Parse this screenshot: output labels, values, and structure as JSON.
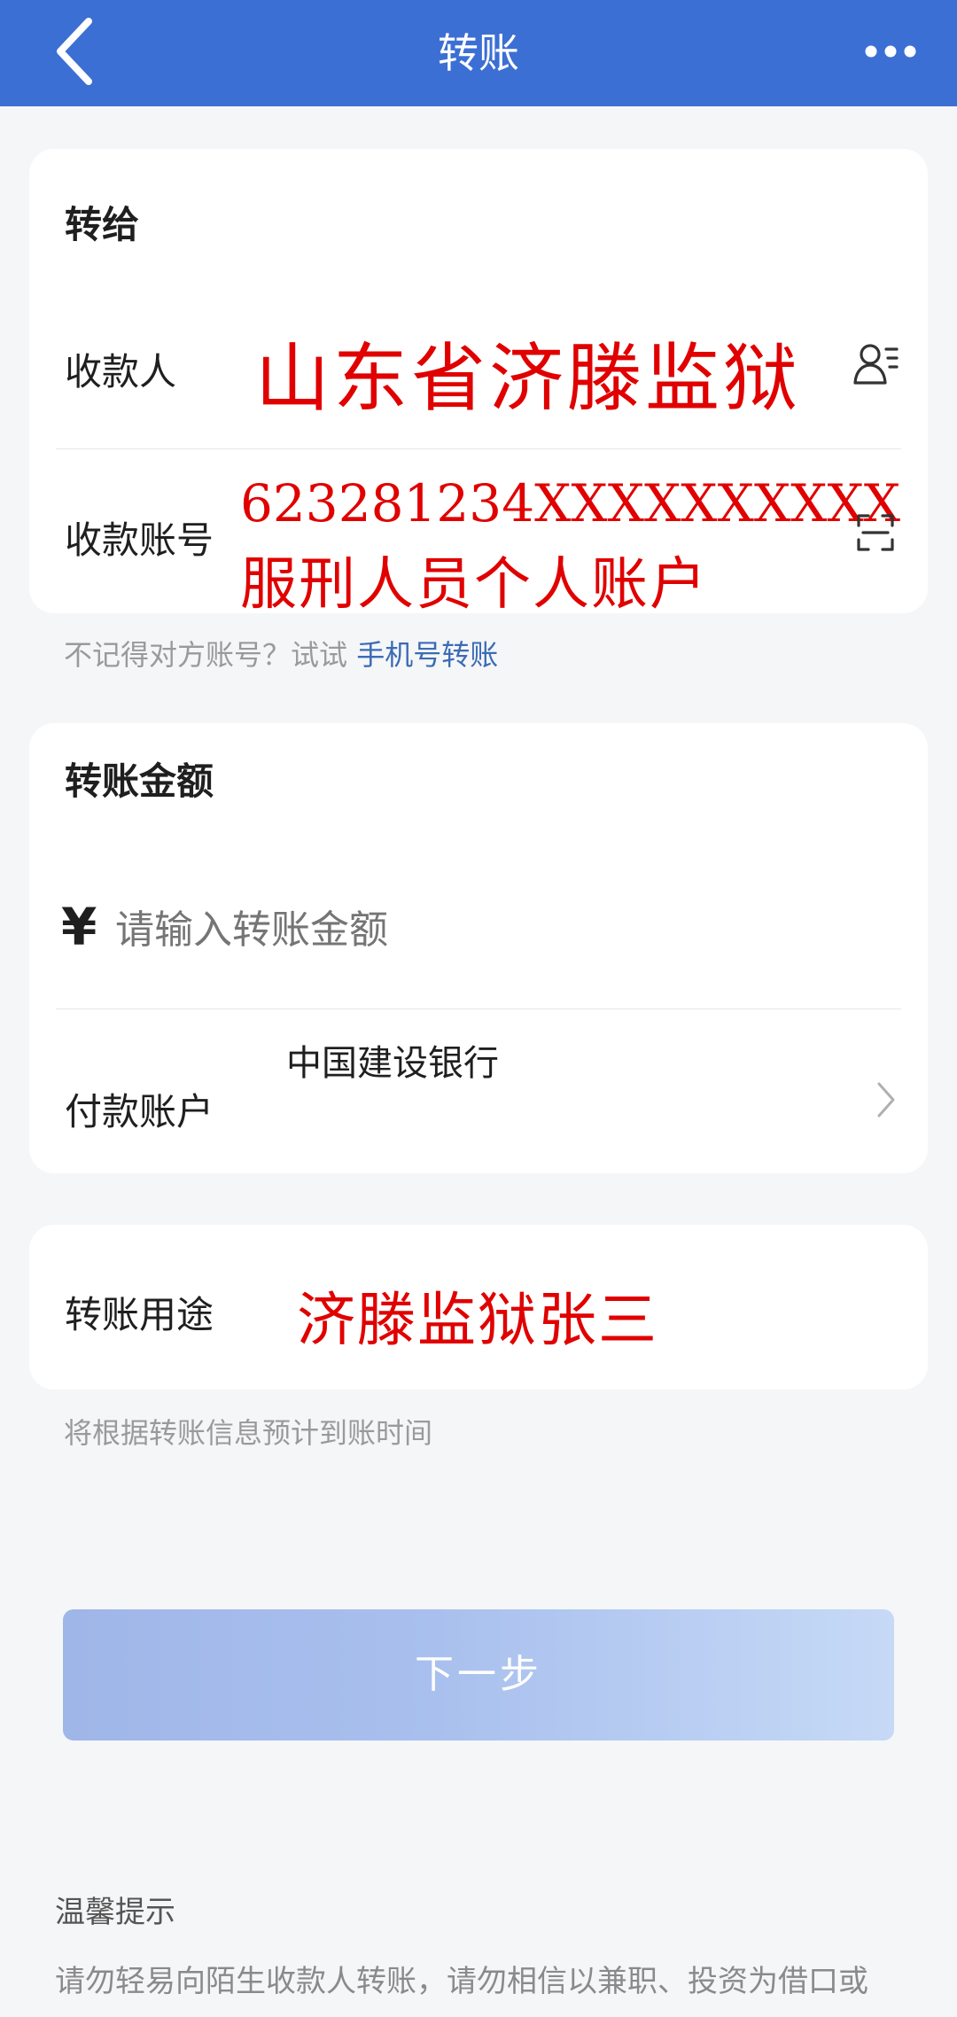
{
  "header": {
    "title": "转账",
    "back_icon": "chevron-left-icon",
    "more_icon": "more-horizontal-icon",
    "color": "#3c6fd4"
  },
  "recipient_card": {
    "title": "转给",
    "payee_label": "收款人",
    "payee_value": "山东省济滕监狱",
    "payee_icon": "contacts-icon",
    "account_label": "收款账号",
    "account_number": "623281234XXXXXXXXXX",
    "account_note": "服刑人员个人账户",
    "account_icon": "scan-icon"
  },
  "phone_hint": {
    "prefix": "不记得对方账号？试试",
    "link": "手机号转账"
  },
  "amount_card": {
    "title": "转账金额",
    "currency_symbol": "¥",
    "amount_placeholder": "请输入转账金额",
    "payer_label": "付款账户",
    "payer_value": "中国建设银行",
    "payer_icon": "chevron-right-icon"
  },
  "purpose_card": {
    "label": "转账用途",
    "value": "济滕监狱张三"
  },
  "arrival_hint": "将根据转账信息预计到账时间",
  "next_button": "下一步",
  "tips": {
    "title": "温馨提示",
    "text": "请勿轻易向陌生收款人转账，请勿相信以兼职、投资为借口或"
  },
  "colors": {
    "annotation_red": "#e00000",
    "link_blue": "#3b6bb5",
    "background": "#f5f6f8"
  }
}
